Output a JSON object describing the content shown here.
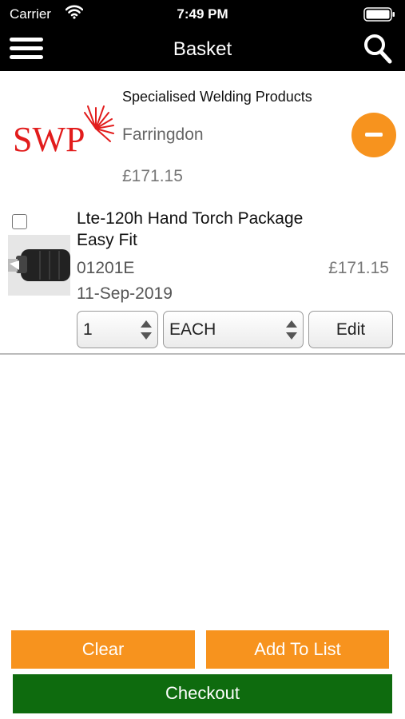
{
  "status_bar": {
    "carrier": "Carrier",
    "time": "7:49 PM"
  },
  "nav": {
    "title": "Basket",
    "menu_icon": "hamburger-menu-icon",
    "search_icon": "search-icon"
  },
  "supplier": {
    "logo_text": "SWP",
    "name": "Specialised Welding Products",
    "branch": "Farringdon",
    "total": "£171.15",
    "remove_icon": "minus-circle-icon"
  },
  "items": [
    {
      "name": "Lte-120h Hand Torch Package Easy Fit",
      "code": "01201E",
      "price": "£171.15",
      "date": "11-Sep-2019",
      "quantity": "1",
      "unit": "EACH",
      "edit_label": "Edit",
      "checked": false
    }
  ],
  "actions": {
    "clear_label": "Clear",
    "add_to_list_label": "Add To List",
    "checkout_label": "Checkout"
  },
  "colors": {
    "accent_orange": "#f7931e",
    "checkout_green": "#0e6b0e",
    "logo_red": "#e21c1c"
  }
}
